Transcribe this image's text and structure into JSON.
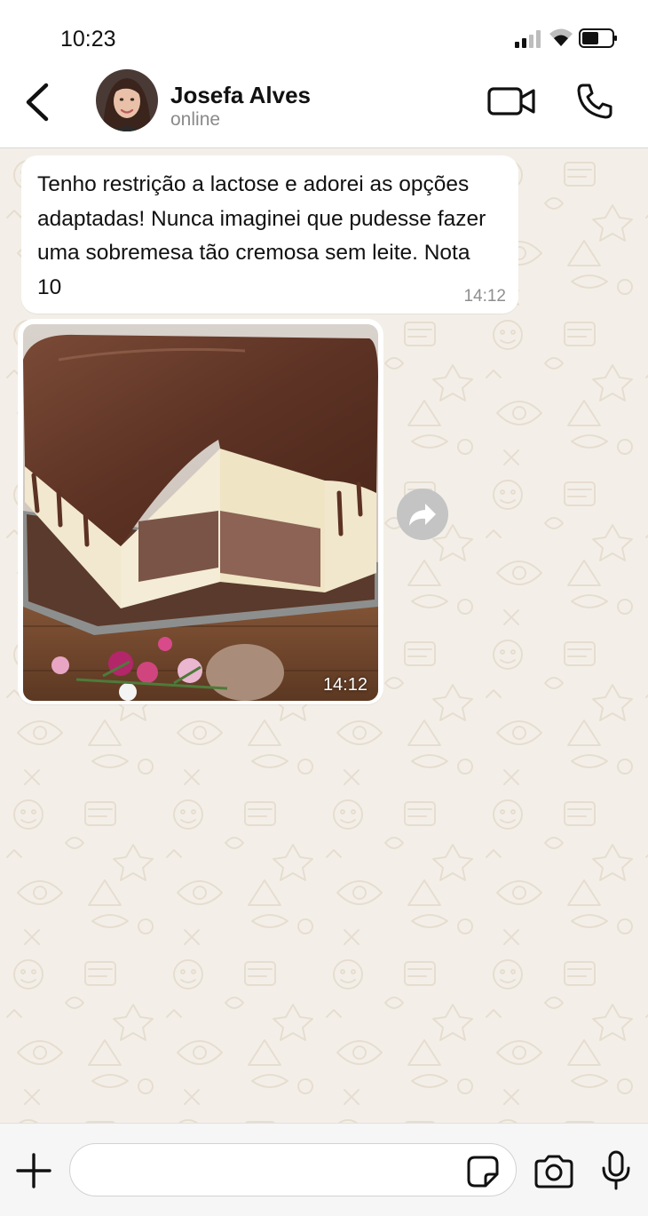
{
  "status_bar": {
    "time": "10:23",
    "signal_bars": 2
  },
  "header": {
    "contact_name": "Josefa Alves",
    "contact_status": "online"
  },
  "messages": [
    {
      "type": "text",
      "text": "Tenho restrição a lactose e adorei as opções adaptadas! Nunca imaginei que pudesse fazer uma sobremesa tão cremosa sem leite. Nota 10",
      "time": "14:12"
    },
    {
      "type": "image",
      "subject": "chocolate-covered layered ice cream cake",
      "time": "14:12"
    }
  ],
  "input": {
    "placeholder": ""
  },
  "icons": [
    "back-icon",
    "video-call-icon",
    "phone-icon",
    "forward-icon",
    "plus-icon",
    "sticker-icon",
    "camera-icon",
    "microphone-icon"
  ],
  "colors": {
    "chat_background": "#f3efe8",
    "bubble": "#ffffff",
    "header": "#ffffff",
    "time_text": "#8e8e8e"
  }
}
